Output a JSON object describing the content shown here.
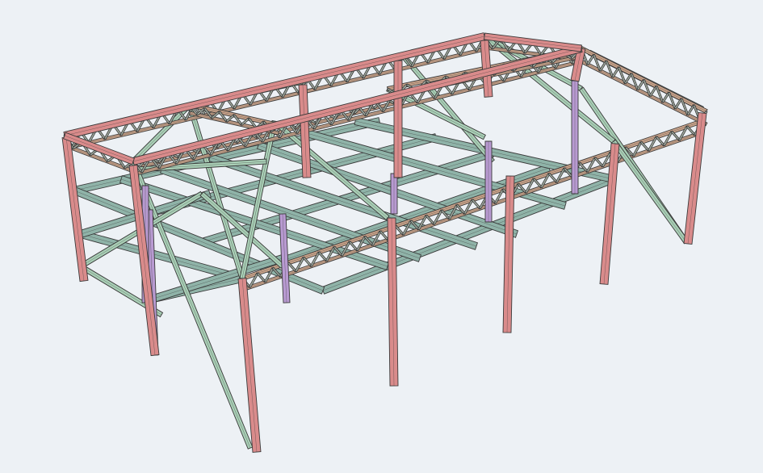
{
  "viewport": {
    "background": "#edf1f5",
    "interaction": "3d-model-view"
  },
  "colors": {
    "column": "#d98b8b",
    "column_edge": "#7a3b3b",
    "column_secondary": "#b89ad1",
    "floor_beam": "#8fb3a8",
    "bracing": "#a9cfb6",
    "truss_chord": "#c9a38a",
    "truss_web": "#c8d6c6",
    "edge": "#3a3a3a"
  },
  "model": {
    "type": "steel-frame-structure",
    "members": [
      "columns",
      "roof-trusses",
      "floor-beams",
      "diagonal-bracing",
      "secondary-columns"
    ]
  }
}
